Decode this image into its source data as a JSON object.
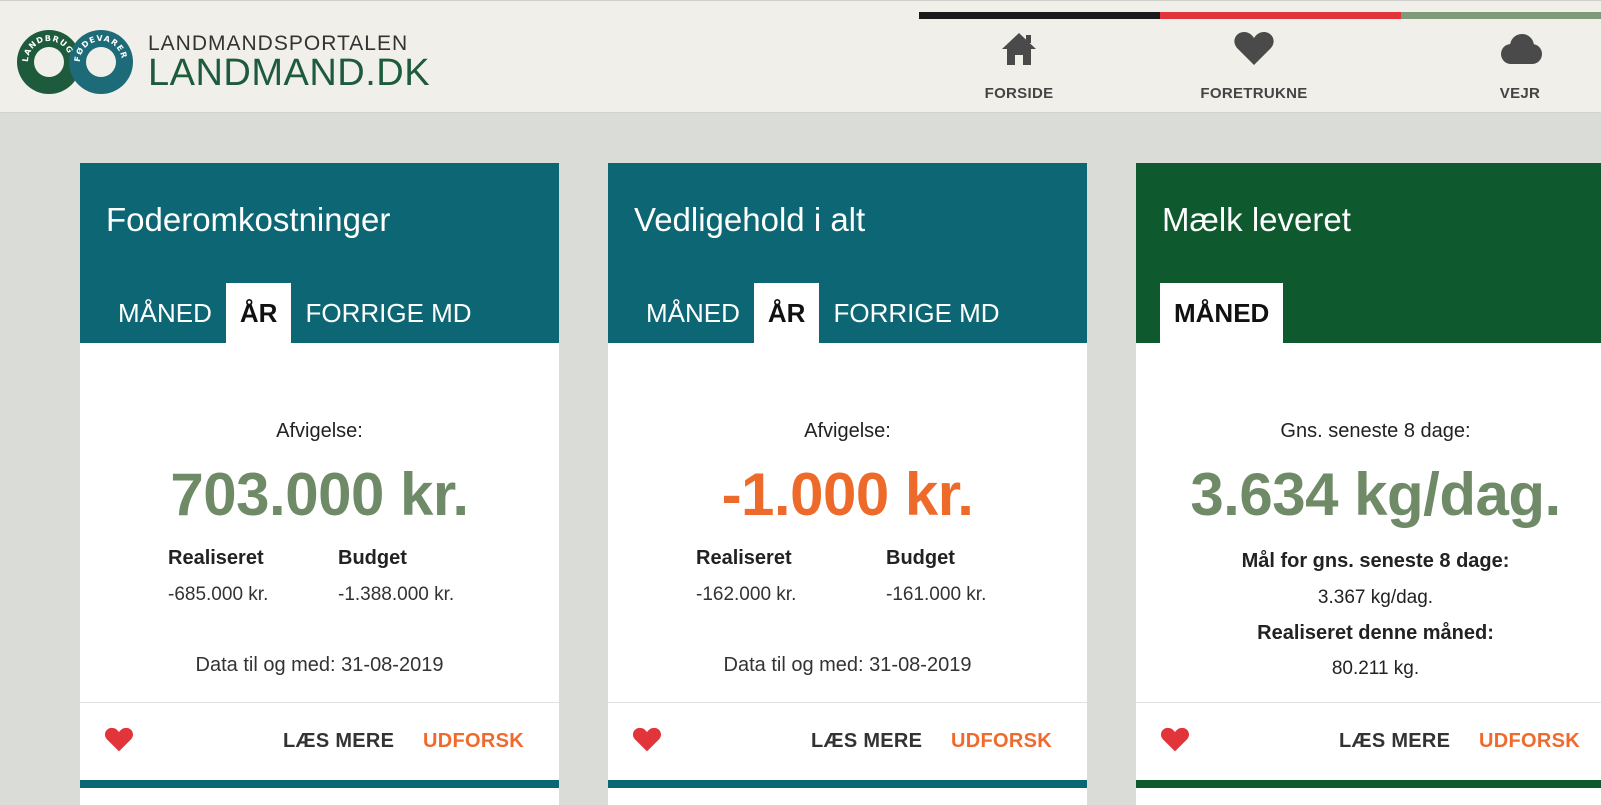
{
  "header": {
    "logo": {
      "ring_left_text": "LANDBRUG",
      "ring_right_text": "FØDEVARER",
      "top_text": "LANDMANDSPORTALEN",
      "main_text": "LANDMAND.DK"
    },
    "nav": [
      {
        "label": "FORSIDE",
        "icon": "home-icon"
      },
      {
        "label": "FORETRUKNE",
        "icon": "heart-icon"
      },
      {
        "label": "VEJR",
        "icon": "cloud-icon"
      }
    ],
    "bar_colors": [
      "#1b1b1b",
      "#e2343b",
      "#7f9a7b"
    ]
  },
  "cards": [
    {
      "title": "Foderomkostninger",
      "header_color": "#0d6673",
      "tabs": [
        "MÅNED",
        "ÅR",
        "FORRIGE MD"
      ],
      "active_tab": "ÅR",
      "label": "Afvigelse:",
      "value": "703.000 kr.",
      "value_color": "#6f8a66",
      "realiseret_label": "Realiseret",
      "realiseret_value": "-685.000 kr.",
      "budget_label": "Budget",
      "budget_value": "-1.388.000 kr.",
      "data_date": "Data til og med: 31-08-2019",
      "laes_mere": "LÆS MERE",
      "udforsk": "UDFORSK"
    },
    {
      "title": "Vedligehold i alt",
      "header_color": "#0d6673",
      "tabs": [
        "MÅNED",
        "ÅR",
        "FORRIGE MD"
      ],
      "active_tab": "ÅR",
      "label": "Afvigelse:",
      "value": "-1.000 kr.",
      "value_color": "#ee6a2b",
      "realiseret_label": "Realiseret",
      "realiseret_value": "-162.000 kr.",
      "budget_label": "Budget",
      "budget_value": "-161.000 kr.",
      "data_date": "Data til og med: 31-08-2019",
      "laes_mere": "LÆS MERE",
      "udforsk": "UDFORSK"
    },
    {
      "title": "Mælk leveret",
      "header_color": "#0e5a2e",
      "tabs": [
        "MÅNED"
      ],
      "active_tab": "MÅNED",
      "label": "Gns. seneste 8 dage:",
      "value": "3.634 kg/dag.",
      "value_color": "#6f8a66",
      "goal_label": "Mål for gns. seneste 8 dage:",
      "goal_value": "3.367 kg/dag.",
      "month_label": "Realiseret denne måned:",
      "month_value": "80.211 kg.",
      "laes_mere": "LÆS MERE",
      "udforsk": "UDFORSK"
    }
  ]
}
